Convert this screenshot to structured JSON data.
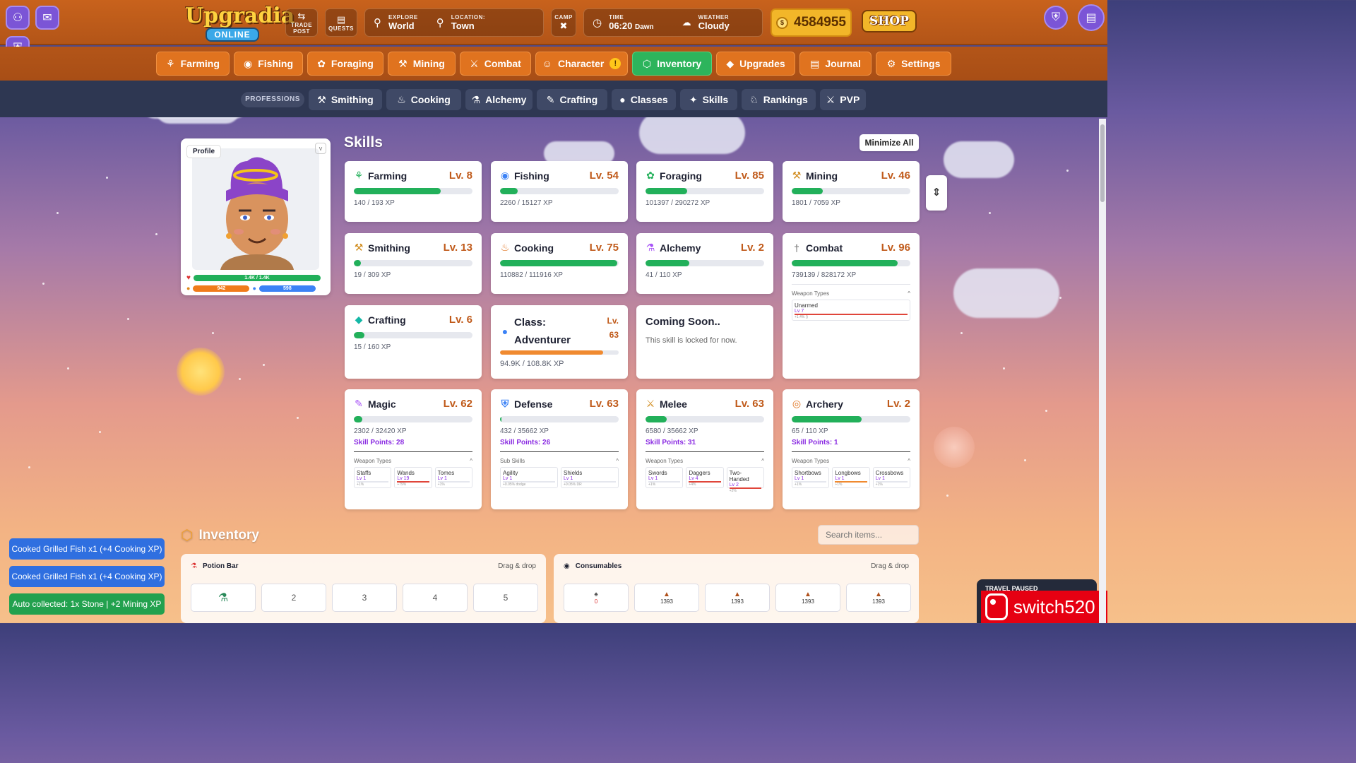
{
  "app": {
    "logo_line1": "Upgradia",
    "logo_line2": "ONLINE"
  },
  "header": {
    "trade_post": "TRADE POST",
    "quests": "QUESTS",
    "explore_label": "EXPLORE",
    "explore_value": "World",
    "location_label": "LOCATION:",
    "location_value": "Town",
    "camp": "CAMP",
    "time_label": "TIME",
    "time_value": "06:20",
    "time_period": "Dawn",
    "weather_label": "WEATHER",
    "weather_value": "Cloudy",
    "coins": "4584955",
    "shop": "SHOP"
  },
  "main_tabs": [
    {
      "label": "Farming",
      "icon": "sprout-icon"
    },
    {
      "label": "Fishing",
      "icon": "fish-icon"
    },
    {
      "label": "Foraging",
      "icon": "leaf-icon"
    },
    {
      "label": "Mining",
      "icon": "pickaxe-icon"
    },
    {
      "label": "Combat",
      "icon": "crossed-swords-icon"
    },
    {
      "label": "Character",
      "icon": "person-icon",
      "badge": "!"
    },
    {
      "label": "Inventory",
      "icon": "box-icon",
      "active": true
    },
    {
      "label": "Upgrades",
      "icon": "gem-icon"
    },
    {
      "label": "Journal",
      "icon": "book-icon"
    },
    {
      "label": "Settings",
      "icon": "gear-icon"
    }
  ],
  "sub_nav": {
    "professions_label": "PROFESSIONS",
    "tabs": [
      "Smithing",
      "Cooking",
      "Alchemy",
      "Crafting",
      "Classes",
      "Skills",
      "Rankings",
      "PVP"
    ]
  },
  "profile": {
    "tag": "Profile",
    "hp": "1.4K / 1.4K",
    "stamina": "942",
    "mana": "598"
  },
  "skills_section": {
    "title": "Skills",
    "minimize_all": "Minimize All"
  },
  "skills": {
    "farming": {
      "name": "Farming",
      "level": "Lv. 8",
      "xp": "140 / 193 XP",
      "progress": 0.73
    },
    "fishing": {
      "name": "Fishing",
      "level": "Lv. 54",
      "xp": "2260 / 15127 XP",
      "progress": 0.15
    },
    "foraging": {
      "name": "Foraging",
      "level": "Lv. 85",
      "xp": "101397 / 290272 XP",
      "progress": 0.35
    },
    "mining": {
      "name": "Mining",
      "level": "Lv. 46",
      "xp": "1801 / 7059 XP",
      "progress": 0.26
    },
    "smithing": {
      "name": "Smithing",
      "level": "Lv. 13",
      "xp": "19 / 309 XP",
      "progress": 0.06
    },
    "cooking": {
      "name": "Cooking",
      "level": "Lv. 75",
      "xp": "110882 / 111916 XP",
      "progress": 0.99
    },
    "alchemy": {
      "name": "Alchemy",
      "level": "Lv. 2",
      "xp": "41 / 110 XP",
      "progress": 0.37
    },
    "combat": {
      "name": "Combat",
      "level": "Lv. 96",
      "xp": "739139 / 828172 XP",
      "progress": 0.89,
      "weapon_types_label": "Weapon Types",
      "unarmed": "Unarmed",
      "unarmed_lv": "Lv 7",
      "unarmed_extra": "+1.4% ()"
    },
    "crafting": {
      "name": "Crafting",
      "level": "Lv. 6",
      "xp": "15 / 160 XP",
      "progress": 0.09
    },
    "class": {
      "name_line1": "Class:",
      "name_line2": "Adventurer",
      "level_line1": "Lv.",
      "level_line2": "63",
      "xp": "94.9K / 108.8K XP",
      "progress": 0.87
    },
    "coming_soon": {
      "title": "Coming Soon..",
      "text": "This skill is locked for now."
    },
    "magic": {
      "name": "Magic",
      "level": "Lv. 62",
      "xp": "2302 / 32420 XP",
      "progress": 0.07,
      "skill_points": "Skill Points: 28",
      "sub_label": "Weapon Types",
      "subs": [
        {
          "name": "Staffs",
          "lv": "Lv 1",
          "extra": "+1%"
        },
        {
          "name": "Wands",
          "lv": "Lv 19",
          "extra": "+79%"
        },
        {
          "name": "Tomes",
          "lv": "Lv 1",
          "extra": "+1%"
        }
      ]
    },
    "defense": {
      "name": "Defense",
      "level": "Lv. 63",
      "xp": "432 / 35662 XP",
      "progress": 0.01,
      "skill_points": "Skill Points: 26",
      "sub_label": "Sub Skills",
      "subs": [
        {
          "name": "Agility",
          "lv": "Lv 1",
          "extra": "+0.05% dodge"
        },
        {
          "name": "Shields",
          "lv": "Lv 1",
          "extra": "+0.05% DR"
        }
      ]
    },
    "melee": {
      "name": "Melee",
      "level": "Lv. 63",
      "xp": "6580 / 35662 XP",
      "progress": 0.18,
      "skill_points": "Skill Points: 31",
      "sub_label": "Weapon Types",
      "subs": [
        {
          "name": "Swords",
          "lv": "Lv 1",
          "extra": "+1%"
        },
        {
          "name": "Daggers",
          "lv": "Lv 4",
          "extra": "+4%"
        },
        {
          "name": "Two-Handed",
          "lv": "Lv 2",
          "extra": "+2%"
        }
      ]
    },
    "archery": {
      "name": "Archery",
      "level": "Lv. 2",
      "xp": "65 / 110 XP",
      "progress": 0.59,
      "skill_points": "Skill Points: 1",
      "sub_label": "Weapon Types",
      "subs": [
        {
          "name": "Shortbows",
          "lv": "Lv 1",
          "extra": "+1%"
        },
        {
          "name": "Longbows",
          "lv": "Lv 1",
          "extra": "+1%"
        },
        {
          "name": "Crossbows",
          "lv": "Lv 1",
          "extra": "+1%"
        }
      ]
    }
  },
  "inventory": {
    "title": "Inventory",
    "search_placeholder": "Search items...",
    "potion_bar": {
      "title": "Potion Bar",
      "hint": "Drag & drop",
      "slots": [
        "",
        "2",
        "3",
        "4",
        "5"
      ]
    },
    "consumables": {
      "title": "Consumables",
      "hint": "Drag & drop",
      "counts": [
        "0",
        "1393",
        "1393",
        "1393",
        "1393"
      ]
    }
  },
  "toasts": [
    "Cooked Grilled Fish x1 (+4 Cooking XP)",
    "Cooked Grilled Fish x1 (+4 Cooking XP)",
    "Auto collected: 1x Stone | +2 Mining XP"
  ],
  "travel": "TRAVEL PAUSED",
  "watermark": "switch520",
  "colors": {
    "accent_green": "#22b05a",
    "nav_orange": "#e0731f",
    "level_orange": "#c05a1a",
    "skill_points_purple": "#8a2be2"
  }
}
